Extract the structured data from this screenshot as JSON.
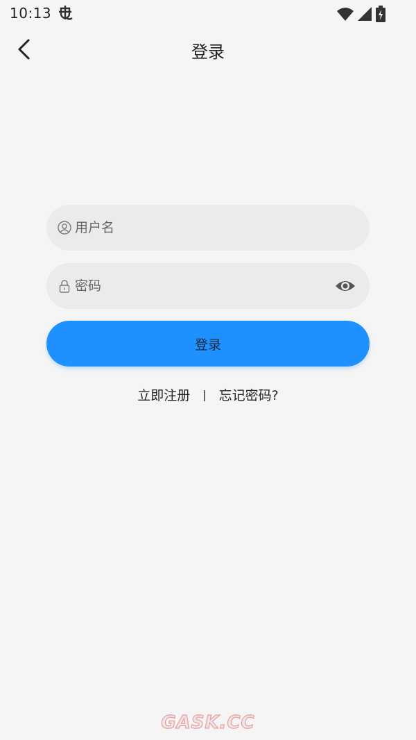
{
  "status_bar": {
    "time": "10:13",
    "icons": [
      "bug-notification-icon",
      "wifi-icon",
      "cellular-signal-icon",
      "battery-charging-icon"
    ]
  },
  "app_bar": {
    "back_icon": "chevron-left-icon",
    "title": "登录"
  },
  "form": {
    "username": {
      "icon": "user-circle-icon",
      "placeholder": "用户名",
      "value": ""
    },
    "password": {
      "icon": "lock-icon",
      "placeholder": "密码",
      "value": "",
      "toggle_icon": "eye-icon"
    },
    "login_label": "登录"
  },
  "links": {
    "register": "立即注册",
    "separator": "|",
    "forgot": "忘记密码?"
  },
  "watermark": "GASK.CC",
  "colors": {
    "background": "#f5f5f5",
    "field_background": "#ebebeb",
    "primary": "#1e90ff",
    "text": "#222222",
    "watermark_stroke": "#ef9a9a"
  }
}
